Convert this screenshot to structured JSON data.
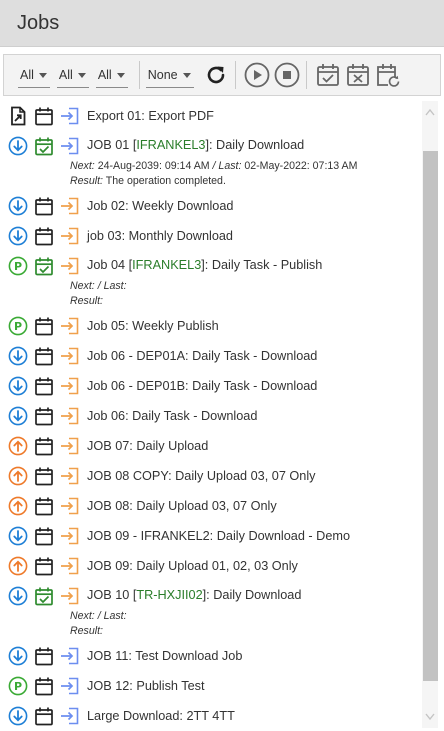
{
  "header": {
    "title": "Jobs"
  },
  "toolbar": {
    "filters": [
      {
        "value": "All"
      },
      {
        "value": "All"
      },
      {
        "value": "All"
      },
      {
        "value": "None"
      }
    ]
  },
  "meta_labels": {
    "next": "Next:",
    "last": "/ Last:",
    "result": "Result:"
  },
  "jobs": [
    {
      "type": "export",
      "schedule": "plain",
      "direction": "in",
      "prefix": "Export 01: Export PDF"
    },
    {
      "type": "download",
      "schedule": "checked",
      "direction": "in",
      "prefix": "JOB 01 [",
      "highlight": "IFRANKEL3",
      "suffix": "]: Daily Download",
      "next": "24-Aug-2039: 09:14 AM",
      "last": "02-May-2022: 07:13 AM",
      "result": "The operation completed."
    },
    {
      "type": "download",
      "schedule": "plain",
      "direction": "out",
      "prefix": "Job 02: Weekly Download"
    },
    {
      "type": "download",
      "schedule": "plain",
      "direction": "out",
      "prefix": "job 03: Monthly Download"
    },
    {
      "type": "publish",
      "schedule": "checked",
      "direction": "out",
      "prefix": "Job 04 [",
      "highlight": "IFRANKEL3",
      "suffix": "]: Daily Task - Publish",
      "next": "",
      "last": "",
      "result": ""
    },
    {
      "type": "publish",
      "schedule": "plain",
      "direction": "out",
      "prefix": "Job 05: Weekly Publish"
    },
    {
      "type": "download",
      "schedule": "plain",
      "direction": "out",
      "prefix": "Job 06 - DEP01A: Daily Task - Download"
    },
    {
      "type": "download",
      "schedule": "plain",
      "direction": "out",
      "prefix": "Job 06 - DEP01B: Daily Task - Download"
    },
    {
      "type": "download",
      "schedule": "plain",
      "direction": "out",
      "prefix": "Job 06: Daily Task - Download"
    },
    {
      "type": "upload",
      "schedule": "plain",
      "direction": "out",
      "prefix": "JOB 07: Daily Upload"
    },
    {
      "type": "upload",
      "schedule": "plain",
      "direction": "out",
      "prefix": "JOB 08 COPY: Daily Upload 03, 07 Only"
    },
    {
      "type": "upload",
      "schedule": "plain",
      "direction": "out",
      "prefix": "JOB 08: Daily Upload 03, 07 Only"
    },
    {
      "type": "download",
      "schedule": "plain",
      "direction": "out",
      "prefix": "JOB 09 - IFRANKEL2: Daily Download - Demo"
    },
    {
      "type": "upload",
      "schedule": "plain",
      "direction": "out",
      "prefix": "JOB 09: Daily Upload 01, 02, 03 Only"
    },
    {
      "type": "download",
      "schedule": "checked",
      "direction": "out",
      "prefix": "JOB 10 [",
      "highlight": "TR-HXJII02",
      "suffix": "]: Daily Download",
      "next": "",
      "last": "",
      "result": ""
    },
    {
      "type": "download",
      "schedule": "plain",
      "direction": "in",
      "prefix": "JOB 11: Test Download Job"
    },
    {
      "type": "publish",
      "schedule": "plain",
      "direction": "in",
      "prefix": "JOB 12: Publish Test"
    },
    {
      "type": "download",
      "schedule": "plain",
      "direction": "in",
      "prefix": "Large Download: 2TT 4TT"
    }
  ],
  "colors": {
    "download": "#1e7fd6",
    "publish": "#3aaa35",
    "upload": "#ee7a2a",
    "calendar_plain": "#222222",
    "calendar_checked": "#2e8b2e",
    "arrow_in": "#6c8ef0",
    "arrow_out": "#f0a04b",
    "highlight": "#2a7d2a"
  }
}
